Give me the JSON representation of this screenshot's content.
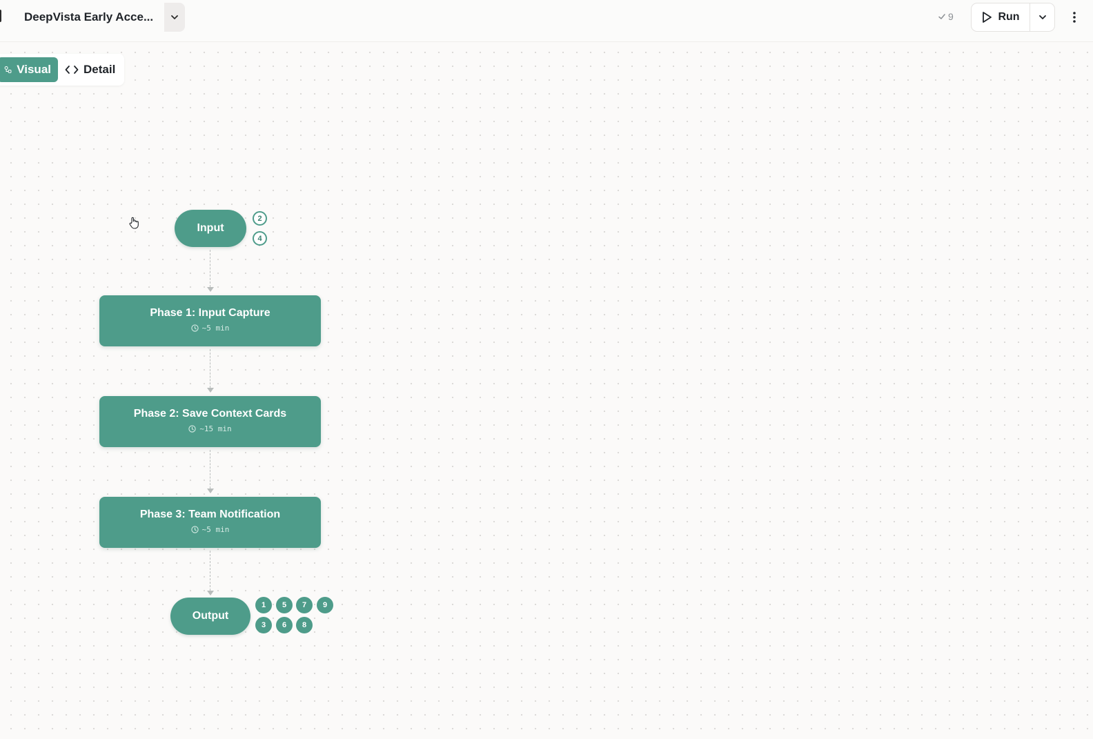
{
  "header": {
    "title": "DeepVista Early Acce...",
    "check_count": "9",
    "run_label": "Run"
  },
  "view_toggle": {
    "visual_label": "Visual",
    "detail_label": "Detail",
    "active": "Visual"
  },
  "flow": {
    "input_label": "Input",
    "input_badges": [
      "2",
      "4"
    ],
    "phases": [
      {
        "title": "Phase 1: Input Capture",
        "duration": "~5 min"
      },
      {
        "title": "Phase 2: Save Context Cards",
        "duration": "~15 min"
      },
      {
        "title": "Phase 3: Team Notification",
        "duration": "~5 min"
      }
    ],
    "output_label": "Output",
    "output_badges_top": [
      "1",
      "5",
      "7",
      "9"
    ],
    "output_badges_bottom": [
      "3",
      "6",
      "8"
    ]
  },
  "colors": {
    "accent": "#4e9c8a",
    "background": "#fbfaf9",
    "connector": "#b9bdbc"
  },
  "icons": {
    "title_dropdown": "chevron-down-icon",
    "check": "check-icon",
    "run": "play-icon",
    "run_dropdown": "chevron-down-icon",
    "more": "kebab-menu-icon",
    "visual": "flow-nodes-icon",
    "detail": "code-icon",
    "duration": "clock-icon"
  }
}
